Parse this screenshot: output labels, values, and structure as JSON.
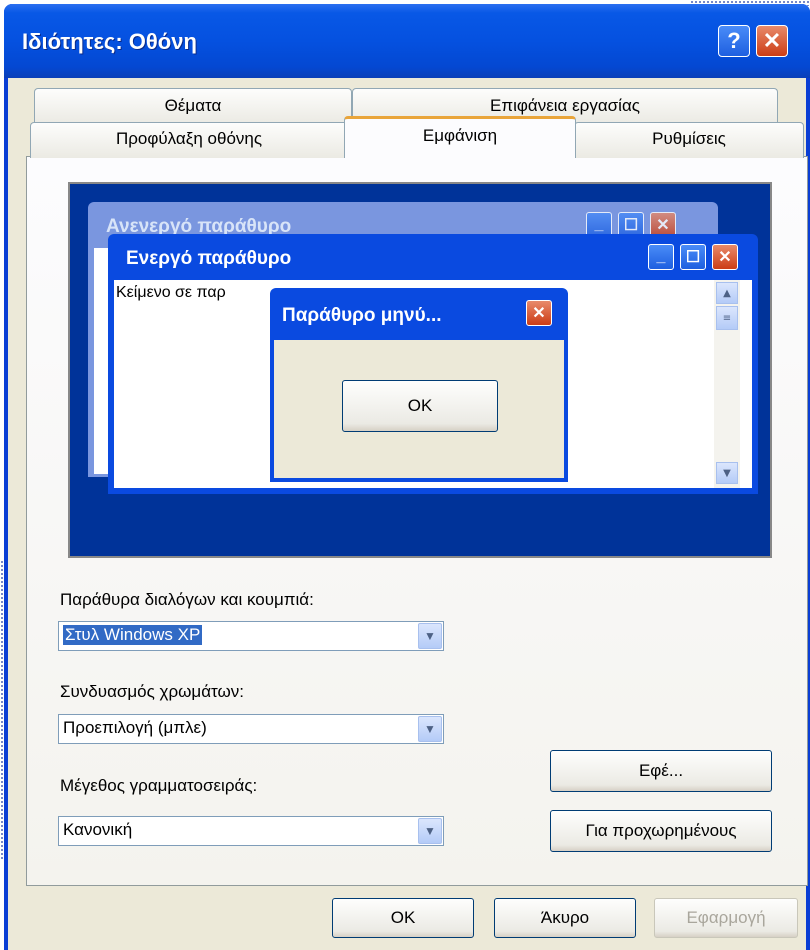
{
  "window": {
    "title": "Ιδιότητες: Οθόνη",
    "help_glyph": "?",
    "close_glyph": "✕"
  },
  "tabs": {
    "row1": [
      "Θέματα",
      "Επιφάνεια εργασίας"
    ],
    "row2": [
      "Προφύλαξη οθόνης",
      "Εμφάνιση",
      "Ρυθμίσεις"
    ],
    "active": "Εμφάνιση"
  },
  "preview": {
    "inactive_title": "Ανενεργό παράθυρο",
    "active_title": "Ενεργό παράθυρο",
    "window_text": "Κείμενο σε παρ",
    "message_title": "Παράθυρο μηνύ...",
    "message_ok": "OK"
  },
  "form": {
    "styles_label": "Παράθυρα διαλόγων και κουμπιά:",
    "styles_value": "Στυλ Windows XP",
    "colors_label": "Συνδυασμός χρωμάτων:",
    "colors_value": "Προεπιλογή (μπλε)",
    "fontsize_label": "Μέγεθος γραμματοσειράς:",
    "fontsize_value": "Κανονική",
    "effects_button": "Εφέ...",
    "advanced_button": "Για προχωρημένους"
  },
  "footer": {
    "ok": "OK",
    "cancel": "Άκυρο",
    "apply": "Εφαρμογή"
  }
}
